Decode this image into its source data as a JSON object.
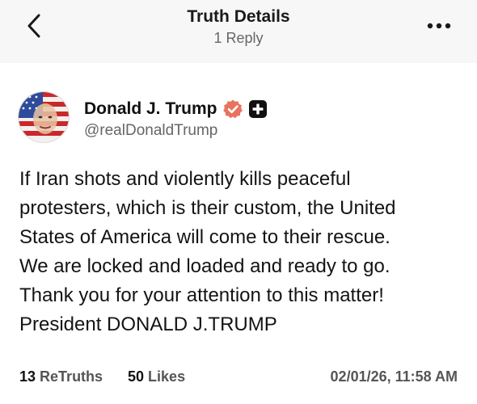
{
  "header": {
    "title": "Truth Details",
    "subtitle": "1 Reply"
  },
  "post": {
    "author_name": "Donald J. Trump",
    "author_handle": "@realDonaldTrump",
    "text": "If Iran shots and violently kills peaceful\nprotesters, which is their custom, the United\nStates of America will come to their rescue.\nWe are locked and loaded and ready to go.\nThank you for your attention to this matter!\nPresident DONALD J.TRUMP",
    "retruths_count": "13",
    "retruths_label": "ReTruths",
    "likes_count": "50",
    "likes_label": "Likes",
    "timestamp": "02/01/26, 11:58 AM"
  },
  "icons": {
    "back": "chevron-left-icon",
    "more": "more-horizontal-icon",
    "verified": "verified-badge-icon",
    "plus": "plus-badge-icon"
  },
  "colors": {
    "verified_badge": "#e8735f",
    "plus_badge": "#111111",
    "header_bg": "#f7f7f7"
  }
}
